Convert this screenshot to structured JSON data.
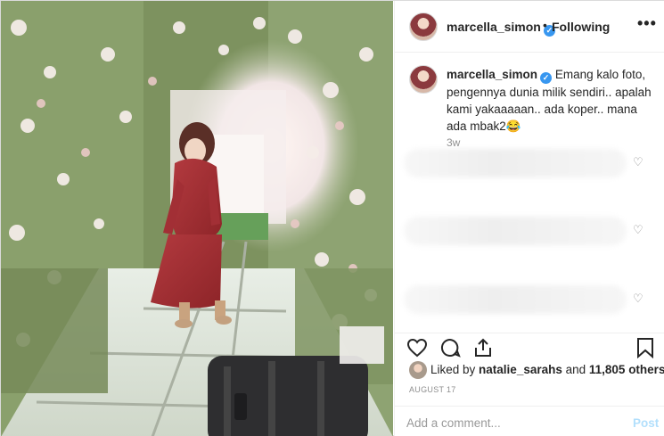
{
  "header": {
    "username": "marcella_simon",
    "separator": "•",
    "follow_status": "Following",
    "more_glyph": "•••"
  },
  "caption": {
    "username": "marcella_simon",
    "text": "Emang kalo foto, pengennya dunia milik sendiri.. apalah kami yakaaaaan.. ada koper.. mana ada mbak2😂",
    "time": "3w"
  },
  "comments": [
    {
      "like_icon": "heart-outline-icon"
    },
    {
      "like_icon": "heart-outline-icon"
    },
    {
      "like_icon": "heart-outline-icon"
    }
  ],
  "actions": {
    "icons": [
      "heart-outline-icon",
      "comment-bubble-icon",
      "share-icon",
      "bookmark-icon"
    ]
  },
  "likes": {
    "prefix": "Liked by ",
    "user": "natalie_sarahs",
    "middle": " and ",
    "count": "11,805 others"
  },
  "post_date": "AUGUST 17",
  "comment_box": {
    "placeholder": "Add a comment...",
    "post_label": "Post"
  },
  "colors": {
    "verified": "#3897f0",
    "post_button": "#b2dffc",
    "muted_text": "#8e8e8e",
    "dress": "#9e2a2f"
  }
}
